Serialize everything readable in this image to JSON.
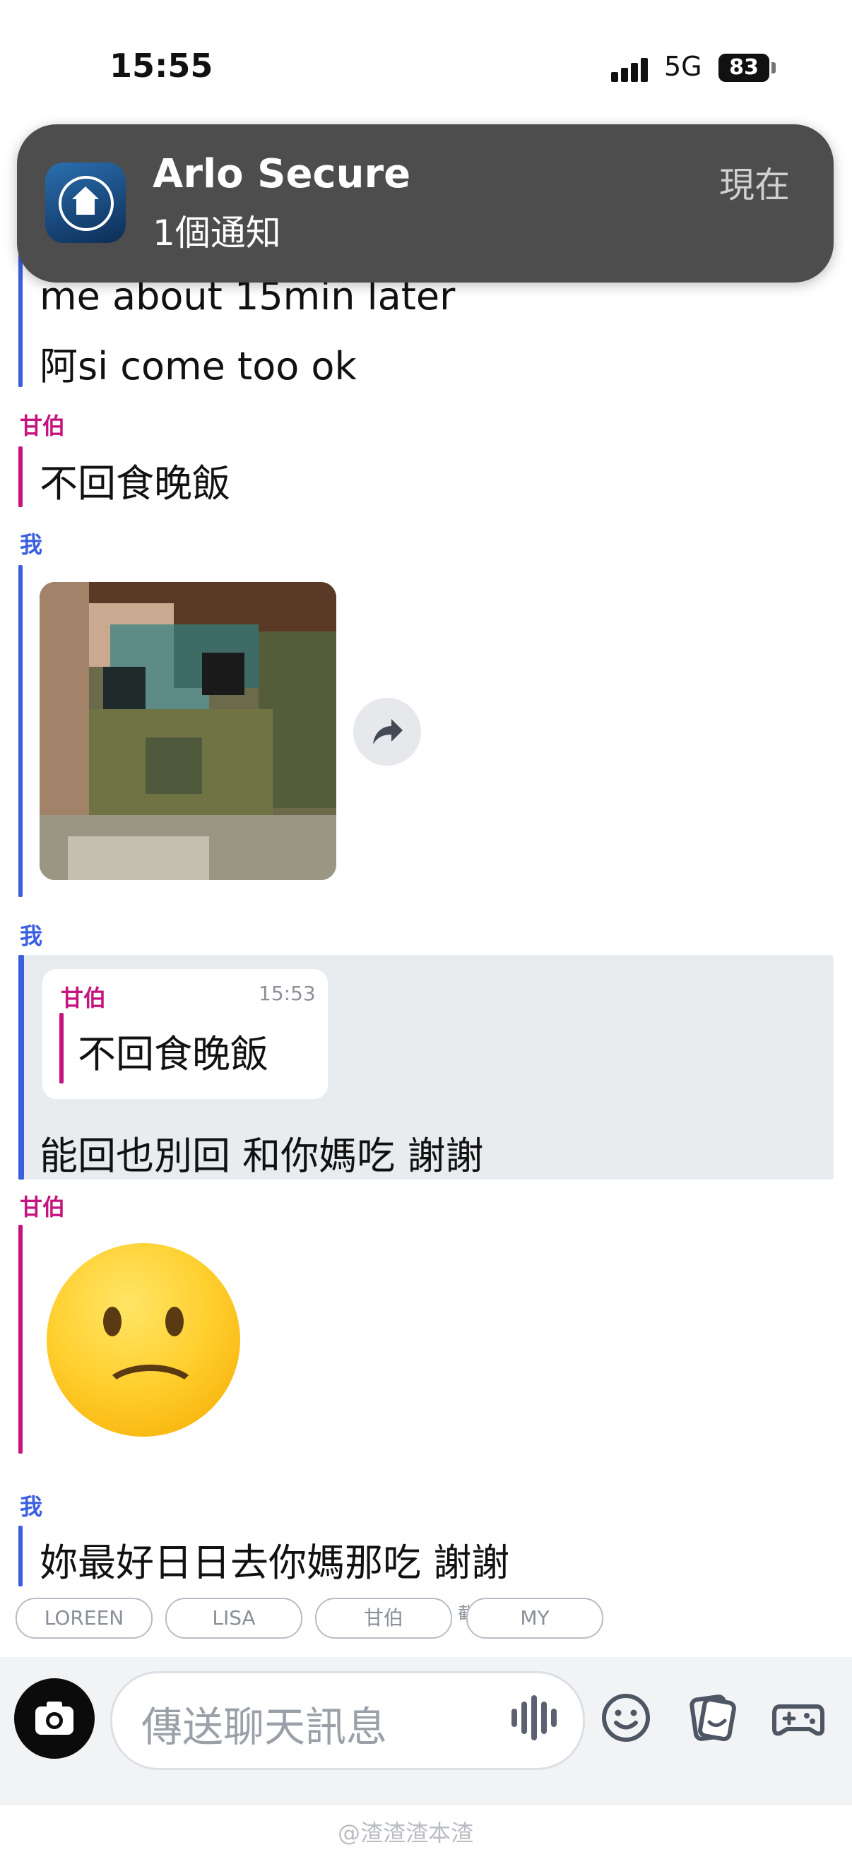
{
  "status_bar": {
    "time": "15:55",
    "network": "5G",
    "battery": "83"
  },
  "notification": {
    "app": "Arlo Secure",
    "message": "1個通知",
    "time": "現在"
  },
  "messages": {
    "m1_line1": "me about 15min later",
    "m1_line2": "阿si come too ok",
    "m2_sender": "甘伯",
    "m2_text": "不回食晚飯",
    "m3_sender": "我",
    "m4_sender": "我",
    "m4_quote_sender": "甘伯",
    "m4_quote_time": "15:53",
    "m4_quote_text": "不回食晚飯",
    "m4_text": "能回也別回 和你媽吃 謝謝",
    "m5_sender": "甘伯",
    "m6_sender": "我",
    "m6_text": "妳最好日日去你媽那吃 謝謝"
  },
  "chips": [
    "LOREEN",
    "LISA",
    "甘伯",
    "MY"
  ],
  "chip_overflow": "截",
  "composer": {
    "placeholder": "傳送聊天訊息"
  },
  "watermark": "@渣渣渣本渣",
  "colors": {
    "me": "#3b5fe0",
    "friend": "#c6147f"
  },
  "icons": [
    "camera-icon",
    "voice-wave-icon",
    "emoji-icon",
    "sticker-icon",
    "game-controller-icon",
    "share-icon"
  ]
}
